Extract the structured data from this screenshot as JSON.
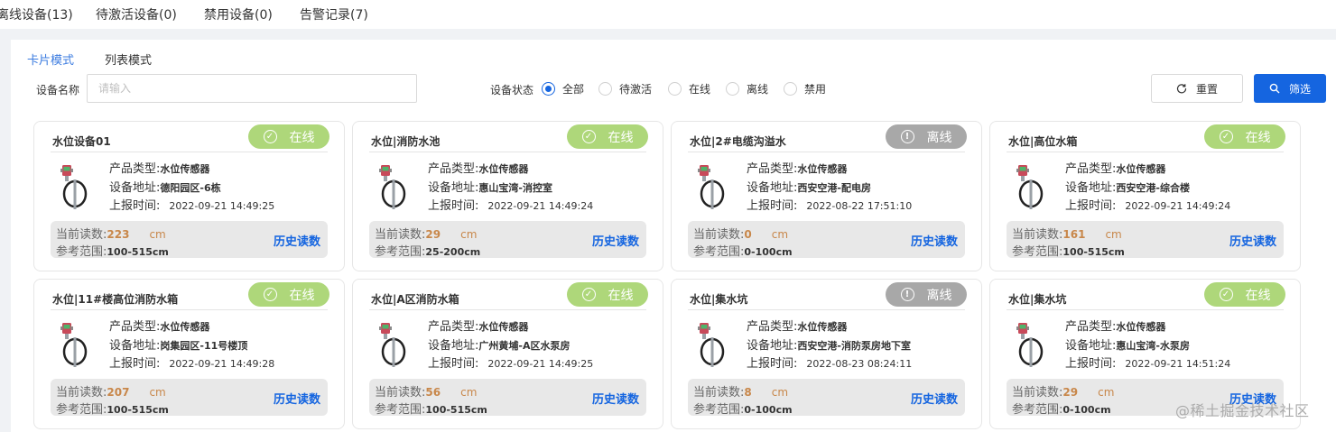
{
  "top_tabs": [
    "离线设备(13)",
    "待激活设备(0)",
    "禁用设备(0)",
    "告警记录(7)"
  ],
  "view_modes": {
    "card": "卡片模式",
    "list": "列表模式"
  },
  "filters": {
    "device_name_label": "设备名称",
    "device_name_placeholder": "请输入",
    "status_label": "设备状态",
    "status_options": [
      "全部",
      "待激活",
      "在线",
      "离线",
      "禁用"
    ],
    "status_selected": "全部",
    "reset_label": "重置",
    "filter_label": "筛选"
  },
  "field_labels": {
    "product_type": "产品类型:",
    "address": "设备地址:",
    "report_time": "上报时间:",
    "current_reading": "当前读数:",
    "ref_range": "参考范围:",
    "history": "历史读数"
  },
  "status_labels": {
    "online": "在线",
    "offline": "离线"
  },
  "colors": {
    "accent": "#1565e0",
    "online": "#aed77a",
    "offline": "#a8a8a8",
    "reading": "#c8874a"
  },
  "devices": [
    {
      "name": "水位设备01",
      "status": "online",
      "status_label": "在线",
      "product_type": "水位传感器",
      "address": "德阳园区-6栋",
      "report_time": "2022-09-21 14:49:25",
      "reading": "223",
      "unit": "cm",
      "range": "100-515cm"
    },
    {
      "name": "水位|消防水池",
      "status": "online",
      "status_label": "在线",
      "product_type": "水位传感器",
      "address": "惠山宝湾-消控室",
      "report_time": "2022-09-21 14:49:24",
      "reading": "29",
      "unit": "cm",
      "range": "25-200cm"
    },
    {
      "name": "水位|2#电缆沟溢水",
      "status": "offline",
      "status_label": "离线",
      "product_type": "水位传感器",
      "address": "西安空港-配电房",
      "report_time": "2022-08-22 17:51:10",
      "reading": "0",
      "unit": "cm",
      "range": "0-100cm"
    },
    {
      "name": "水位|高位水箱",
      "status": "online",
      "status_label": "在线",
      "product_type": "水位传感器",
      "address": "西安空港-综合楼",
      "report_time": "2022-09-21 14:49:24",
      "reading": "161",
      "unit": "cm",
      "range": "100-515cm"
    },
    {
      "name": "水位|11#楼高位消防水箱",
      "status": "online",
      "status_label": "在线",
      "product_type": "水位传感器",
      "address": "岗集园区-11号楼顶",
      "report_time": "2022-09-21 14:49:28",
      "reading": "207",
      "unit": "cm",
      "range": "100-515cm"
    },
    {
      "name": "水位|A区消防水箱",
      "status": "online",
      "status_label": "在线",
      "product_type": "水位传感器",
      "address": "广州黄埔-A区水泵房",
      "report_time": "2022-09-21 14:49:25",
      "reading": "56",
      "unit": "cm",
      "range": "100-515cm"
    },
    {
      "name": "水位|集水坑",
      "status": "offline",
      "status_label": "离线",
      "product_type": "水位传感器",
      "address": "西安空港-消防泵房地下室",
      "report_time": "2022-08-23 08:24:11",
      "reading": "8",
      "unit": "cm",
      "range": "0-100cm"
    },
    {
      "name": "水位|集水坑",
      "status": "online",
      "status_label": "在线",
      "product_type": "水位传感器",
      "address": "惠山宝湾-水泵房",
      "report_time": "2022-09-21 14:51:24",
      "reading": "29",
      "unit": "cm",
      "range": "0-100cm"
    }
  ],
  "watermark": "@稀土掘金技术社区"
}
